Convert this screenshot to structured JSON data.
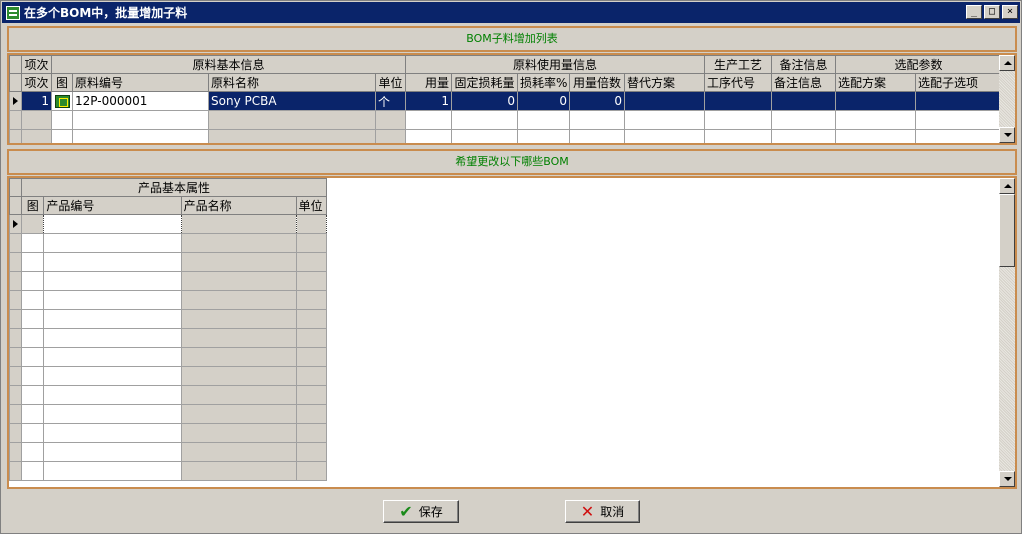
{
  "window": {
    "title": "在多个BOM中，批量增加子料",
    "buttons": {
      "minimize": "_",
      "maximize": "□",
      "close": "×"
    }
  },
  "top_section": {
    "banner": "BOM子料增加列表",
    "group_headers": {
      "seq": "项次",
      "material_basic": "原料基本信息",
      "usage": "原料使用量信息",
      "process": "生产工艺",
      "remark": "备注信息",
      "option": "选配参数"
    },
    "columns": {
      "seq": "项次",
      "image": "图",
      "material_code": "原料编号",
      "material_name": "原料名称",
      "unit": "单位",
      "usage": "用量",
      "fixed_loss": "固定损耗量",
      "loss_rate": "损耗率%",
      "usage_multiple": "用量倍数",
      "alternative": "替代方案",
      "process_code": "工序代号",
      "remark": "备注信息",
      "option_plan": "选配方案",
      "option_sub": "选配子选项"
    },
    "rows": [
      {
        "seq": "1",
        "image": "bom-material-icon",
        "material_code": "12P-000001",
        "material_name": "Sony PCBA",
        "unit": "个",
        "usage": "1",
        "fixed_loss": "0",
        "loss_rate": "0",
        "usage_multiple": "0",
        "alternative": "",
        "process_code": "",
        "remark": "",
        "option_plan": "",
        "option_sub": ""
      }
    ]
  },
  "bottom_section": {
    "banner": "希望更改以下哪些BOM",
    "group_header": "产品基本属性",
    "columns": {
      "image": "图",
      "product_code": "产品编号",
      "product_name": "产品名称",
      "unit": "单位"
    }
  },
  "actions": {
    "save": "保存",
    "cancel": "取消"
  },
  "colors": {
    "titlebar": "#0a246a",
    "frame_border": "#c98c4e",
    "banner_text": "#008000",
    "selection": "#0a246a"
  }
}
